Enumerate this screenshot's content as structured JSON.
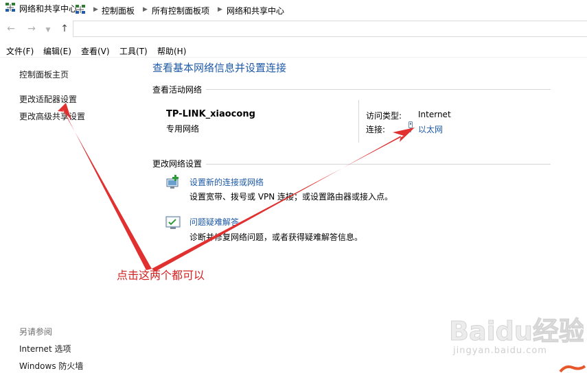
{
  "window": {
    "title": "网络和共享中心"
  },
  "address": {
    "breadcrumbs": [
      "控制面板",
      "所有控制面板项",
      "网络和共享中心"
    ]
  },
  "menu": [
    "文件(F)",
    "编辑(E)",
    "查看(V)",
    "工具(T)",
    "帮助(H)"
  ],
  "sidebar": {
    "links": [
      "控制面板主页",
      "更改适配器设置",
      "更改高级共享设置"
    ],
    "see_also_title": "另请参阅",
    "see_also": [
      "Internet 选项",
      "Windows 防火墙"
    ]
  },
  "main": {
    "heading": "查看基本网络信息并设置连接",
    "active_networks_title": "查看活动网络",
    "network": {
      "name": "TP-LINK_xiaocong",
      "type": "专用网络",
      "access_label": "访问类型:",
      "access_value": "Internet",
      "connection_label": "连接:",
      "connection_value": "以太网"
    },
    "change_settings_title": "更改网络设置",
    "tasks": [
      {
        "link": "设置新的连接或网络",
        "desc": "设置宽带、拨号或 VPN 连接；或设置路由器或接入点。",
        "icon": "new-connection-icon"
      },
      {
        "link": "问题疑难解答",
        "desc": "诊断并修复网络问题，或者获得疑难解答信息。",
        "icon": "troubleshoot-icon"
      }
    ]
  },
  "annotation": {
    "text": "点击这两个都可以",
    "color": "#d42020"
  },
  "watermark": {
    "text": "Baidu经验",
    "sub": "jingyan.baidu.com"
  },
  "colors": {
    "link": "#1e5aa8",
    "arrow": "#e03030"
  }
}
